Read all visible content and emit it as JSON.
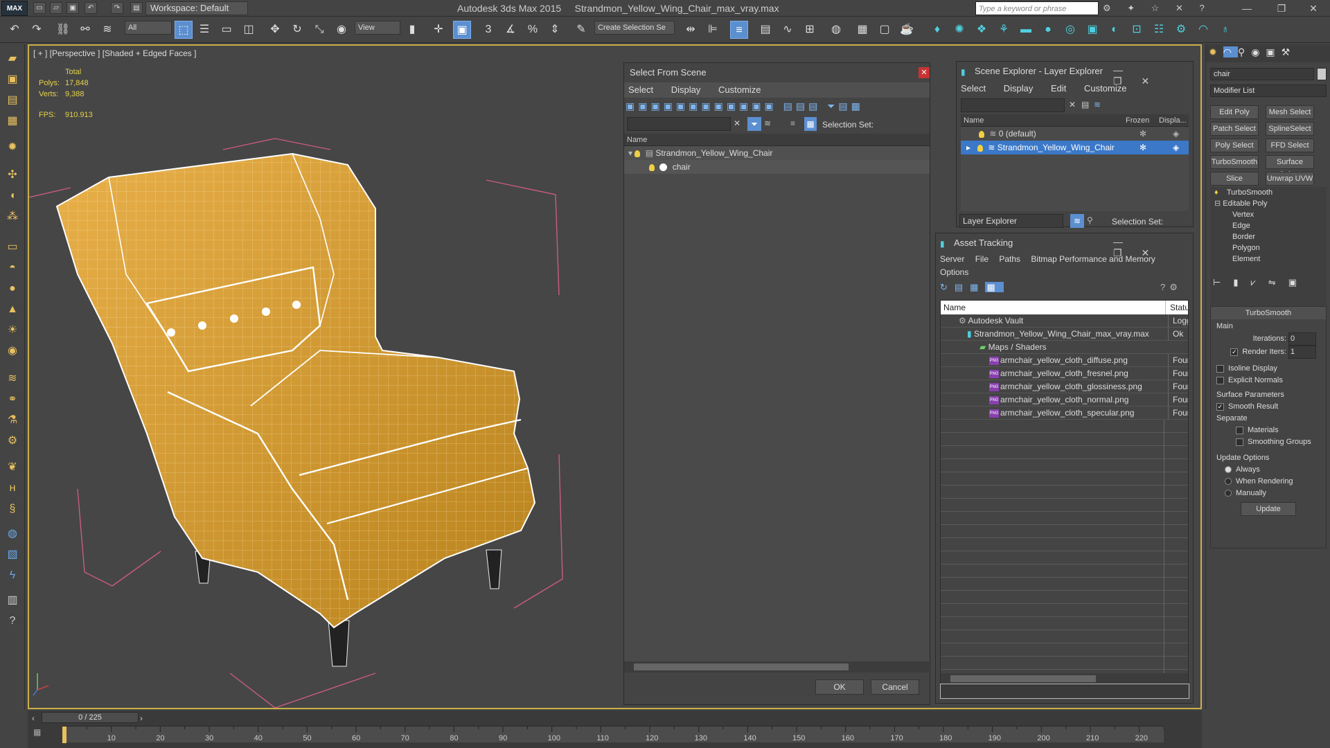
{
  "app": {
    "logo": "MAX",
    "title": "Autodesk 3ds Max  2015",
    "file": "Strandmon_Yellow_Wing_Chair_max_vray.max",
    "workspace": "Workspace: Default",
    "search_placeholder": "Type a keyword or phrase"
  },
  "toolbar": {
    "filter": "All",
    "refcoord": "View",
    "selection_set": "Create Selection Se"
  },
  "viewport": {
    "label": "[ + ] [Perspective ] [Shaded + Edged Faces ]",
    "total_label": "Total",
    "polys_label": "Polys:",
    "polys_value": "17,848",
    "verts_label": "Verts:",
    "verts_value": "9,388",
    "fps_label": "FPS:",
    "fps_value": "910.913",
    "accent": "#cbb04a"
  },
  "select_from_scene": {
    "title": "Select From Scene",
    "menu": [
      "Select",
      "Display",
      "Customize"
    ],
    "selection_set_label": "Selection Set:",
    "col_name": "Name",
    "tree": [
      {
        "name": "Strandmon_Yellow_Wing_Chair"
      },
      {
        "name": "chair"
      }
    ],
    "ok": "OK",
    "cancel": "Cancel"
  },
  "scene_explorer": {
    "title": "Scene Explorer - Layer Explorer",
    "menu": [
      "Select",
      "Display",
      "Edit",
      "Customize"
    ],
    "cols": [
      "Name",
      "Frozen",
      "Displa..."
    ],
    "rows": [
      {
        "name": "0 (default)"
      },
      {
        "name": "Strandmon_Yellow_Wing_Chair"
      }
    ],
    "explorer_select": "Layer Explorer",
    "selection_set_label": "Selection Set:"
  },
  "asset_tracking": {
    "title": "Asset Tracking",
    "menu": [
      "Server",
      "File",
      "Paths",
      "Bitmap Performance and Memory"
    ],
    "menu2": "Options",
    "cols": [
      "Name",
      "Status"
    ],
    "rows": [
      {
        "name": "Autodesk Vault",
        "status": "Logged"
      },
      {
        "name": "Strandmon_Yellow_Wing_Chair_max_vray.max",
        "status": "Ok"
      },
      {
        "name": "Maps / Shaders",
        "status": ""
      },
      {
        "name": "armchair_yellow_cloth_diffuse.png",
        "status": "Found"
      },
      {
        "name": "armchair_yellow_cloth_fresnel.png",
        "status": "Found"
      },
      {
        "name": "armchair_yellow_cloth_glossiness.png",
        "status": "Found"
      },
      {
        "name": "armchair_yellow_cloth_normal.png",
        "status": "Found"
      },
      {
        "name": "armchair_yellow_cloth_specular.png",
        "status": "Found"
      }
    ]
  },
  "command_panel": {
    "object_name": "chair",
    "modifier_list": "Modifier List",
    "buttons": [
      "Edit Poly",
      "Mesh Select",
      "Patch Select",
      "SplineSelect",
      "Poly Select",
      "FFD Select",
      "TurboSmooth",
      "Surface Select",
      "Slice",
      "Unwrap UVW"
    ],
    "stack": [
      "TurboSmooth",
      "Editable Poly",
      "Vertex",
      "Edge",
      "Border",
      "Polygon",
      "Element"
    ],
    "rollout_title": "TurboSmooth",
    "main_label": "Main",
    "iterations_label": "Iterations:",
    "iterations_value": "0",
    "render_iters_label": "Render Iters:",
    "render_iters_value": "1",
    "isoline": "Isoline Display",
    "explicit_normals": "Explicit Normals",
    "surface_params": "Surface Parameters",
    "smooth_result": "Smooth Result",
    "separate": "Separate",
    "materials": "Materials",
    "smoothing_groups": "Smoothing Groups",
    "update_options": "Update Options",
    "always": "Always",
    "when_rendering": "When Rendering",
    "manually": "Manually",
    "update": "Update"
  },
  "timeline": {
    "frame": "0 / 225",
    "ticks": [
      "10",
      "20",
      "30",
      "40",
      "50",
      "60",
      "70",
      "80",
      "90",
      "100",
      "110",
      "120",
      "130",
      "140",
      "150",
      "160",
      "170",
      "180",
      "190",
      "200",
      "210",
      "220"
    ]
  }
}
